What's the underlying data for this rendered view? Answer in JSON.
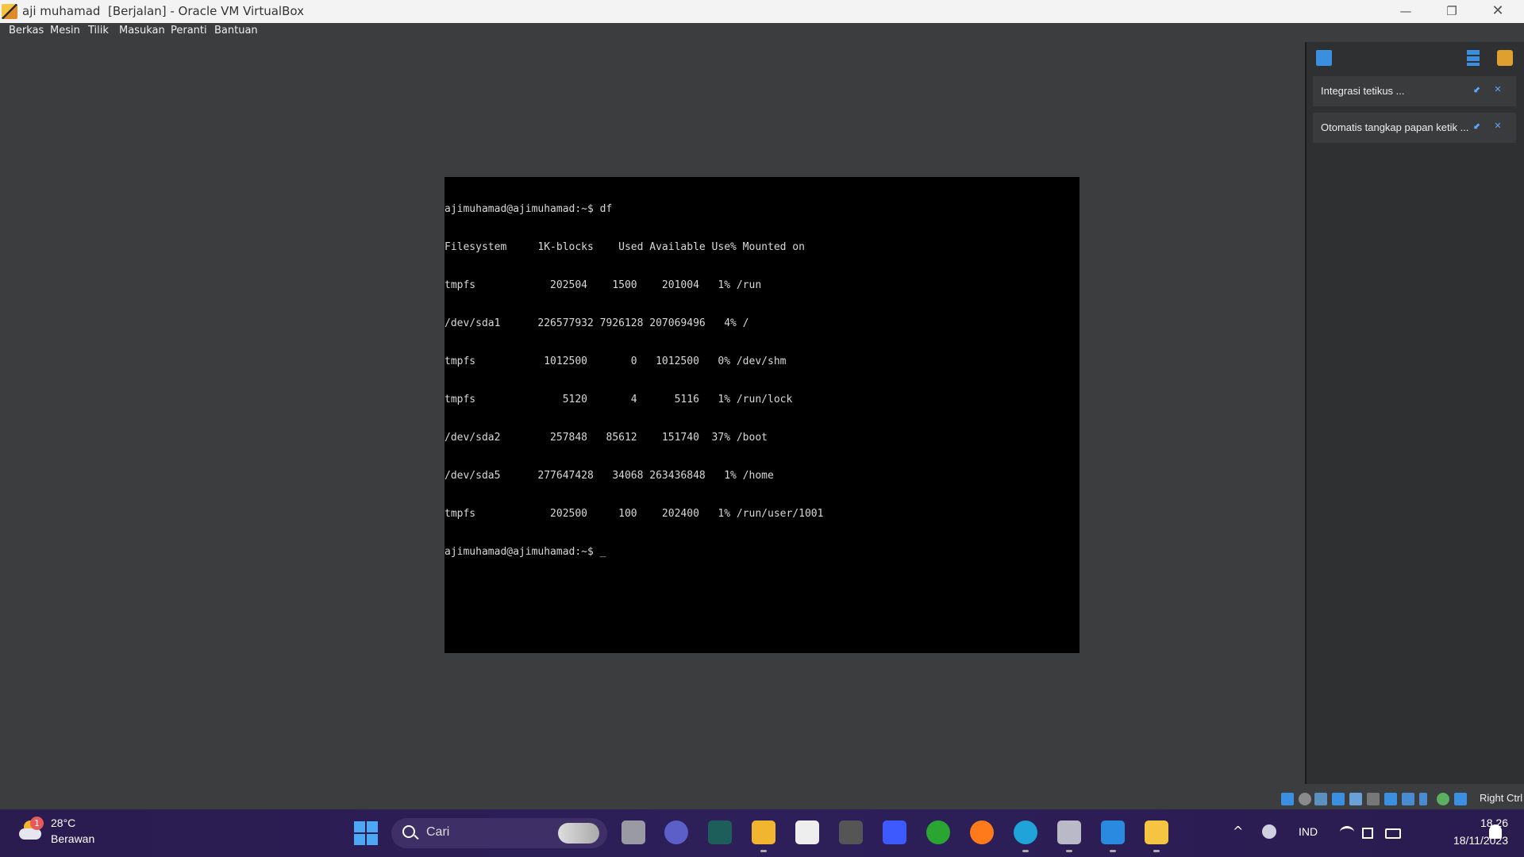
{
  "window": {
    "title": "aji muhamad  [Berjalan] - Oracle VM VirtualBox",
    "minimize_glyph": "—",
    "maximize_glyph": "❐",
    "close_glyph": "✕"
  },
  "menu": {
    "items": [
      {
        "label": "Berkas"
      },
      {
        "label": "Mesin"
      },
      {
        "label": "Tilik"
      },
      {
        "label": "Masukan"
      },
      {
        "label": "Peranti"
      },
      {
        "label": "Bantuan"
      }
    ]
  },
  "terminal": {
    "lines": [
      "ajimuhamad@ajimuhamad:~$ df",
      "Filesystem     1K-blocks    Used Available Use% Mounted on",
      "tmpfs            202504    1500    201004   1% /run",
      "/dev/sda1      226577932 7926128 207069496   4% /",
      "tmpfs           1012500       0   1012500   0% /dev/shm",
      "tmpfs              5120       4      5116   1% /run/lock",
      "/dev/sda2        257848   85612    151740  37% /boot",
      "/dev/sda5      277647428   34068 263436848   1% /home",
      "tmpfs            202500     100    202400   1% /run/user/1001",
      "ajimuhamad@ajimuhamad:~$ _"
    ]
  },
  "notifications": {
    "items": [
      {
        "text": "Integrasi tetikus ..."
      },
      {
        "text": "Otomatis tangkap papan ketik ..."
      }
    ],
    "hide_glyph": "⬋",
    "close_glyph": "✕"
  },
  "statusbar": {
    "host_key": "Right Ctrl",
    "icons": [
      "hard-disk-icon",
      "optical-drive-icon",
      "audio-icon",
      "network-icon",
      "usb-icon",
      "shared-folder-icon",
      "display-icon",
      "recording-icon",
      "cpu-icon",
      "mouse-integration-icon",
      "keyboard-icon"
    ]
  },
  "taskbar": {
    "weather": {
      "temp": "28°C",
      "condition": "Berawan",
      "badge": "1"
    },
    "search_placeholder": "Cari",
    "apps": [
      "file-manager-icon",
      "teams-icon",
      "terminal-app-icon",
      "file-explorer-icon",
      "store-icon",
      "unity-icon",
      "editor-icon",
      "xbox-icon",
      "firefox-icon",
      "edge-icon",
      "virtualbox-icon",
      "paint-icon",
      "vm-window-icon"
    ],
    "tray": {
      "language": "IND",
      "chevron": "^"
    },
    "clock": {
      "time": "18.26",
      "date": "18/11/2023"
    }
  },
  "colors": {
    "background": "#3c3d3f",
    "terminal_bg": "#000000",
    "terminal_fg": "#d8d8d8",
    "taskbar": "#2d1f59",
    "accent": "#3b8fe0"
  }
}
